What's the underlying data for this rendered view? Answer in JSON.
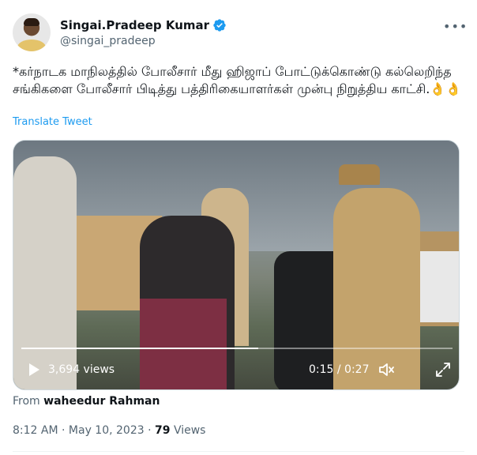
{
  "author": {
    "display_name": "Singai.Pradeep Kumar",
    "handle": "@singai_pradeep"
  },
  "tweet": {
    "text": "*கர்நாடக மாநிலத்தில் போலீசார் மீது ஹிஜாப் போட்டுக்கொண்டு கல்லெறிந்த சங்கிகளை போலீசார் பிடித்து பத்திரிகையாளர்கள் முன்பு நிறுத்திய காட்சி.👌👌",
    "translate_label": "Translate Tweet"
  },
  "video": {
    "views_label": "3,694 views",
    "time_label": "0:15 / 0:27",
    "progress": 0.55
  },
  "attribution": {
    "prefix": "From",
    "source": "waheedur Rahman"
  },
  "meta": {
    "time": "8:12 AM",
    "sep1": "·",
    "date": "May 10, 2023",
    "sep2": "·",
    "views_count": "79",
    "views_label": "Views"
  },
  "colors": {
    "accent": "#1d9bf0",
    "secondary_text": "#536471"
  }
}
